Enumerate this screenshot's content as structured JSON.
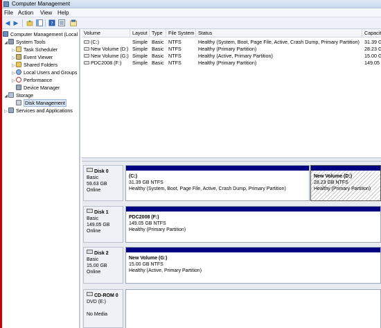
{
  "window": {
    "title": "Computer Management"
  },
  "menu": [
    "File",
    "Action",
    "View",
    "Help"
  ],
  "toolbar": {
    "icons": [
      "back-arrow-icon",
      "forward-arrow-icon",
      "up-folder-icon",
      "show-hide-tree-icon",
      "help-icon",
      "properties-icon",
      "export-icon"
    ]
  },
  "tree": {
    "root": "Computer Management (Local",
    "system_tools": "System Tools",
    "task_scheduler": "Task Scheduler",
    "event_viewer": "Event Viewer",
    "shared_folders": "Shared Folders",
    "local_users": "Local Users and Groups",
    "performance": "Performance",
    "device_manager": "Device Manager",
    "storage": "Storage",
    "disk_management": "Disk Management",
    "services": "Services and Applications"
  },
  "volume_list": {
    "columns": [
      "Volume",
      "Layout",
      "Type",
      "File System",
      "Status",
      "Capacit"
    ],
    "rows": [
      {
        "volume": "(C:)",
        "layout": "Simple",
        "type": "Basic",
        "fs": "NTFS",
        "status": "Healthy (System, Boot, Page File, Active, Crash Dump, Primary Partition)",
        "capacity": "31.39 G"
      },
      {
        "volume": "New Volume (D:)",
        "layout": "Simple",
        "type": "Basic",
        "fs": "NTFS",
        "status": "Healthy (Primary Partition)",
        "capacity": "28.23 G"
      },
      {
        "volume": "New Volume (G:)",
        "layout": "Simple",
        "type": "Basic",
        "fs": "NTFS",
        "status": "Healthy (Active, Primary Partition)",
        "capacity": "15.00 G"
      },
      {
        "volume": "PDC2008 (F:)",
        "layout": "Simple",
        "type": "Basic",
        "fs": "NTFS",
        "status": "Healthy (Primary Partition)",
        "capacity": "149.05 G"
      }
    ]
  },
  "disks": {
    "disk0": {
      "name": "Disk 0",
      "type": "Basic",
      "size": "59.63 GB",
      "state": "Online",
      "p1": {
        "name": "(C:)",
        "size": "31.39 GB NTFS",
        "status": "Healthy (System, Boot, Page File, Active, Crash Dump, Primary Partition)"
      },
      "p2": {
        "name": "New Volume  (D:)",
        "size": "28.23 GB NTFS",
        "status": "Healthy (Primary Partition)"
      }
    },
    "disk1": {
      "name": "Disk 1",
      "type": "Basic",
      "size": "149.05 GB",
      "state": "Online",
      "p1": {
        "name": "PDC2008  (F:)",
        "size": "149.05 GB NTFS",
        "status": "Healthy (Primary Partition)"
      }
    },
    "disk2": {
      "name": "Disk 2",
      "type": "Basic",
      "size": "15.00 GB",
      "state": "Online",
      "p1": {
        "name": "New Volume  (G:)",
        "size": "15.00 GB NTFS",
        "status": "Healthy (Active, Primary Partition)"
      }
    },
    "cdrom0": {
      "name": "CD-ROM 0",
      "type": "DVD (E:)",
      "state": "No Media"
    }
  },
  "colors": {
    "primary_partition_band": "#000080",
    "selection": "#d9e6f6",
    "accent_edge": "#cc0000"
  }
}
